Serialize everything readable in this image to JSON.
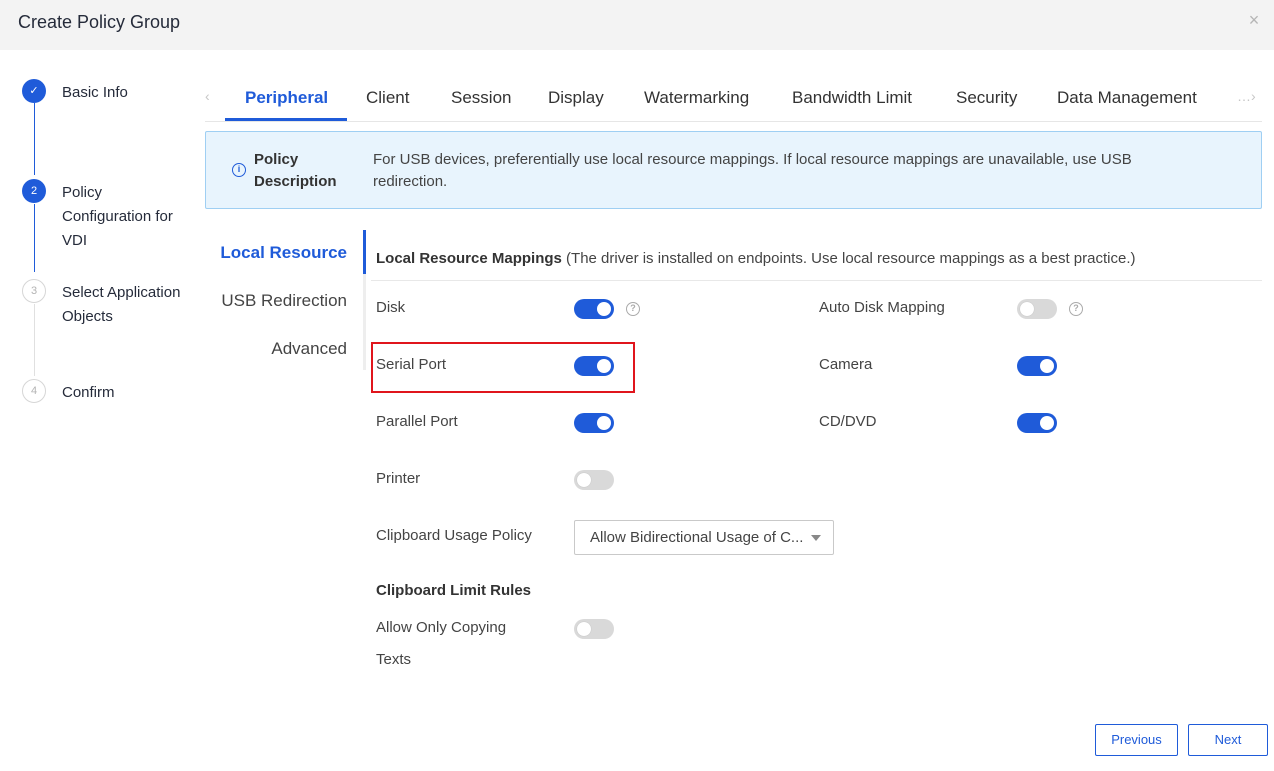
{
  "header": {
    "title": "Create Policy Group",
    "close_icon": "×"
  },
  "stepper": {
    "steps": [
      {
        "number": "✓",
        "label": "Basic Info",
        "state": "done"
      },
      {
        "number": "2",
        "label": "Policy Configuration for VDI",
        "state": "active"
      },
      {
        "number": "3",
        "label": "Select Application Objects",
        "state": "pending"
      },
      {
        "number": "4",
        "label": "Confirm",
        "state": "pending"
      }
    ]
  },
  "tabs": {
    "prev_icon": "‹",
    "next_icon": "›",
    "overflow": "…",
    "items": [
      "Peripheral",
      "Client",
      "Session",
      "Display",
      "Watermarking",
      "Bandwidth Limit",
      "Security",
      "Data Management"
    ],
    "active": "Peripheral"
  },
  "description": {
    "icon": "info-icon",
    "label": "Policy Description",
    "text": "For USB devices, preferentially use local resource mappings. If local resource mappings are unavailable, use USB redirection."
  },
  "subnav": {
    "items": [
      "Local Resource",
      "USB Redirection",
      "Advanced"
    ],
    "active": "Local Resource"
  },
  "section": {
    "title_bold": "Local Resource Mappings",
    "title_note": " (The driver is installed on endpoints. Use local resource mappings as a best practice.)"
  },
  "fields": {
    "disk": {
      "label": "Disk",
      "on": true
    },
    "auto_disk_mapping": {
      "label": "Auto Disk Mapping",
      "on": false
    },
    "serial_port": {
      "label": "Serial Port",
      "on": true
    },
    "camera": {
      "label": "Camera",
      "on": true
    },
    "parallel_port": {
      "label": "Parallel Port",
      "on": true
    },
    "cd_dvd": {
      "label": "CD/DVD",
      "on": true
    },
    "printer": {
      "label": "Printer",
      "on": false
    },
    "clipboard_policy": {
      "label": "Clipboard Usage Policy",
      "value": "Allow Bidirectional Usage of C..."
    }
  },
  "clipboard_rules": {
    "heading": "Clipboard Limit Rules",
    "allow_only_text": {
      "label_line1": "Allow Only Copying",
      "label_line2": "Texts",
      "on": false
    }
  },
  "footer": {
    "previous": "Previous",
    "next": "Next"
  },
  "colors": {
    "primary": "#1f5bd9",
    "highlight": "#e0151c",
    "info_bg": "#e8f4fd"
  }
}
